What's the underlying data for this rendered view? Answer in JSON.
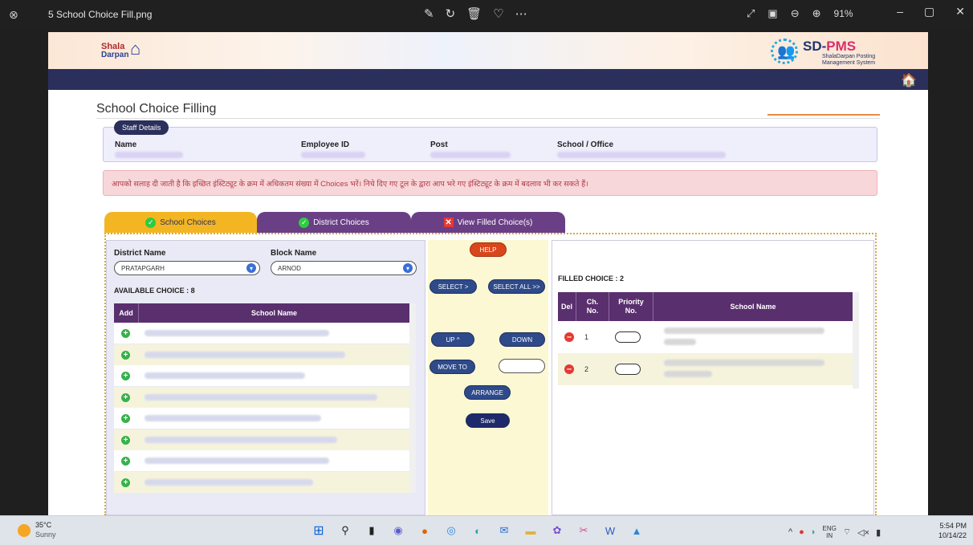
{
  "viewer": {
    "file_name": "5 School Choice Fill.png",
    "zoom": "91%"
  },
  "site": {
    "logo_left_line1": "Shala",
    "logo_left_line2": "Darpan",
    "logo_right_brand": "SD-",
    "logo_right_brand_accent": "PMS",
    "logo_right_sub1": "ShalaDarpan Posting",
    "logo_right_sub2": "Management System"
  },
  "page": {
    "title": "School Choice Filling",
    "staff_pill": "Staff Details",
    "staff_labels": [
      "Name",
      "Employee ID",
      "Post",
      "School / Office"
    ],
    "alert": "आपको सलाह दी जाती है कि इच्छित इंस्टिट्यूट के क्रम में अधिकतम संख्या में Choices भरें। निचे दिए गए टूल के द्वारा आप भरे गए इंस्टिट्यूट के क्रम में बदलाव भी कर सकते हैं।"
  },
  "tabs": {
    "school": "School Choices",
    "district": "District Choices",
    "view": "View Filled Choice(s)"
  },
  "left": {
    "district_label": "District Name",
    "district_value": "PRATAPGARH",
    "block_label": "Block Name",
    "block_value": "ARNOD",
    "available": "AVAILABLE CHOICE : 8",
    "col_add": "Add",
    "col_school": "School Name",
    "rows": 8
  },
  "middle": {
    "help": "HELP",
    "select": "SELECT >",
    "select_all": "SELECT ALL >>",
    "up": "UP ^",
    "down": "DOWN",
    "move_to": "MOVE TO",
    "arrange": "ARRANGE",
    "save": "Save"
  },
  "right": {
    "filled": "FILLED CHOICE : 2",
    "col_del": "Del",
    "col_ch1": "Ch.",
    "col_ch2": "No.",
    "col_pri1": "Priority",
    "col_pri2": "No.",
    "col_school": "School Name",
    "rows": [
      {
        "ch": "1"
      },
      {
        "ch": "2"
      }
    ]
  },
  "taskbar": {
    "temp": "35°C",
    "condition": "Sunny",
    "lang1": "ENG",
    "lang2": "IN",
    "time": "5:54 PM",
    "date": "10/14/22"
  },
  "colors": {
    "navbar": "#2b2f5c",
    "tab_active": "#f3b622",
    "tab_inactive": "#6a3f86",
    "table_header": "#5a2f6e",
    "help_button": "#d9461b"
  }
}
